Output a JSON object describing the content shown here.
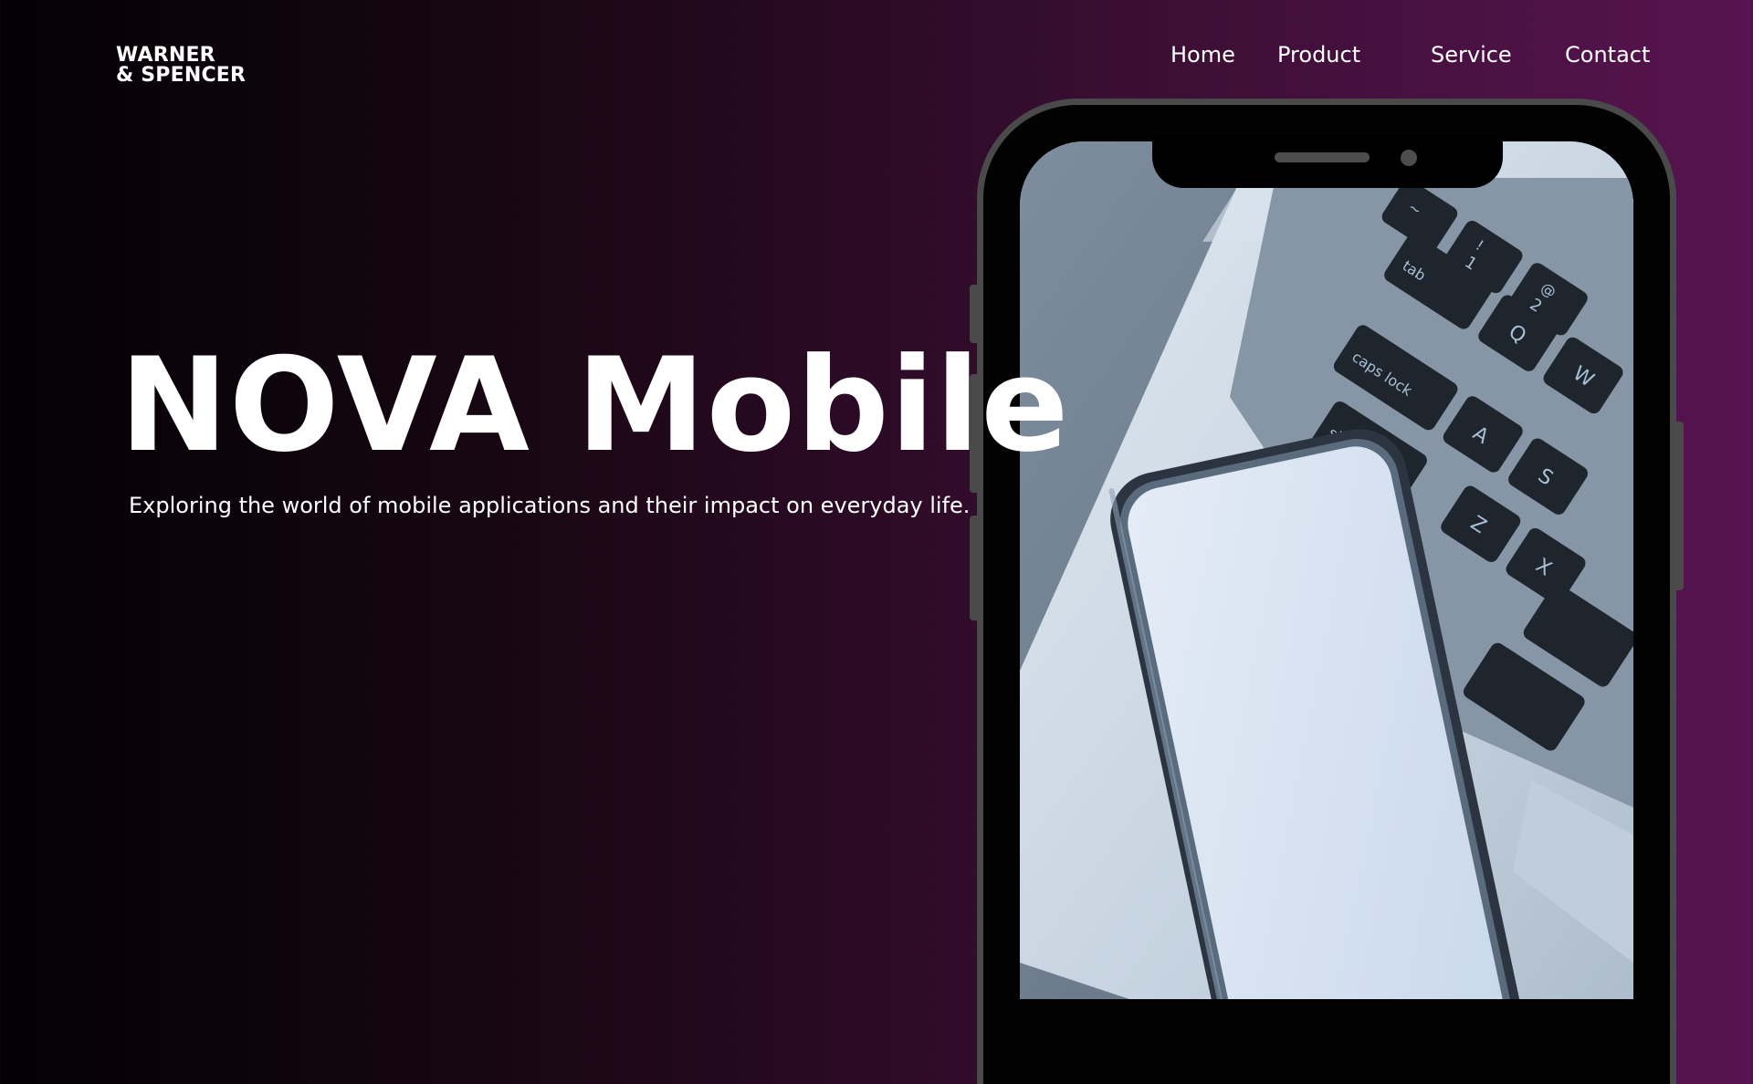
{
  "brand": {
    "line1": "WARNER",
    "line2": "& SPENCER"
  },
  "nav": {
    "items": [
      "Home",
      "Product",
      "Service",
      "Contact"
    ]
  },
  "hero": {
    "title": "NOVA Mobile",
    "subtitle": "Exploring the world of mobile applications and their impact on everyday life."
  },
  "photo": {
    "subject": "smartphone-on-laptop-keyboard",
    "keys": [
      "~",
      "!",
      "1",
      "@",
      "2",
      "tab",
      "Q",
      "W",
      "caps lock",
      "A",
      "S",
      "Z",
      "X",
      "shi"
    ]
  },
  "colors": {
    "gradient_left": "#030104",
    "gradient_right": "#571450",
    "text": "#ffffff",
    "phone_frame": "#4a4a4a"
  }
}
